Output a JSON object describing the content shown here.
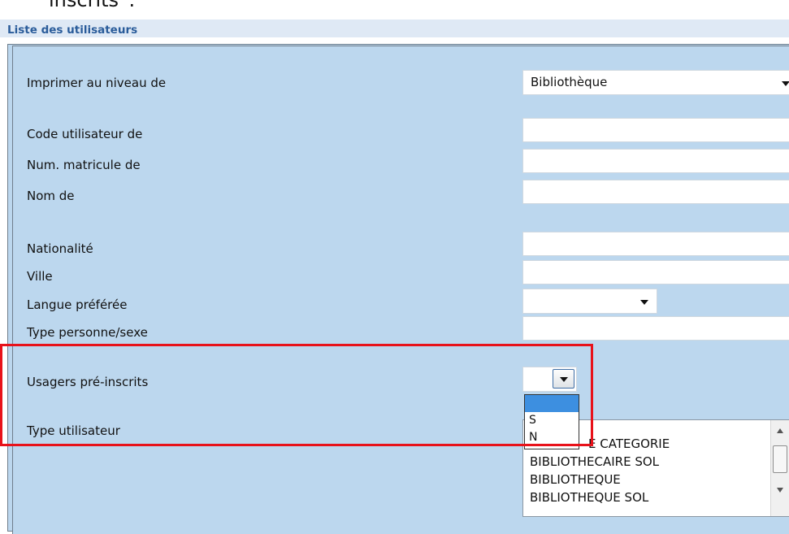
{
  "top_text": "inscrits”.",
  "panel_title": "Liste des utilisateurs",
  "fields": {
    "print_level_label": "Imprimer au niveau de",
    "print_level_value": "Bibliothèque",
    "user_code_label": "Code utilisateur de",
    "user_code_value": "",
    "matricule_label": "Num. matricule de",
    "matricule_value": "",
    "name_label": "Nom de",
    "name_value": "",
    "nationality_label": "Nationalité",
    "nationality_value": "",
    "city_label": "Ville",
    "city_value": "",
    "language_label": "Langue préférée",
    "language_value": "",
    "person_type_label": "Type personne/sexe",
    "person_type_value": "",
    "preregistered_label": "Usagers pré-inscrits",
    "preregistered_value": "",
    "user_type_label": "Type utilisateur"
  },
  "preregistered_options": [
    "",
    "S",
    "N"
  ],
  "user_type_items": [
    "E CATEGORIE",
    "BIBLIOTHECAIRE SOL",
    "BIBLIOTHEQUE",
    "BIBLIOTHEQUE SOL"
  ],
  "colors": {
    "panel_bg": "#bcd7ee",
    "title_color": "#2a5c9a",
    "highlight_border": "#e8121a",
    "selected_option_bg": "#3d8fe0"
  },
  "icons": {
    "dropdown": "chevron-down-icon",
    "scroll_up": "arrow-up-icon",
    "scroll_down": "arrow-down-icon"
  }
}
